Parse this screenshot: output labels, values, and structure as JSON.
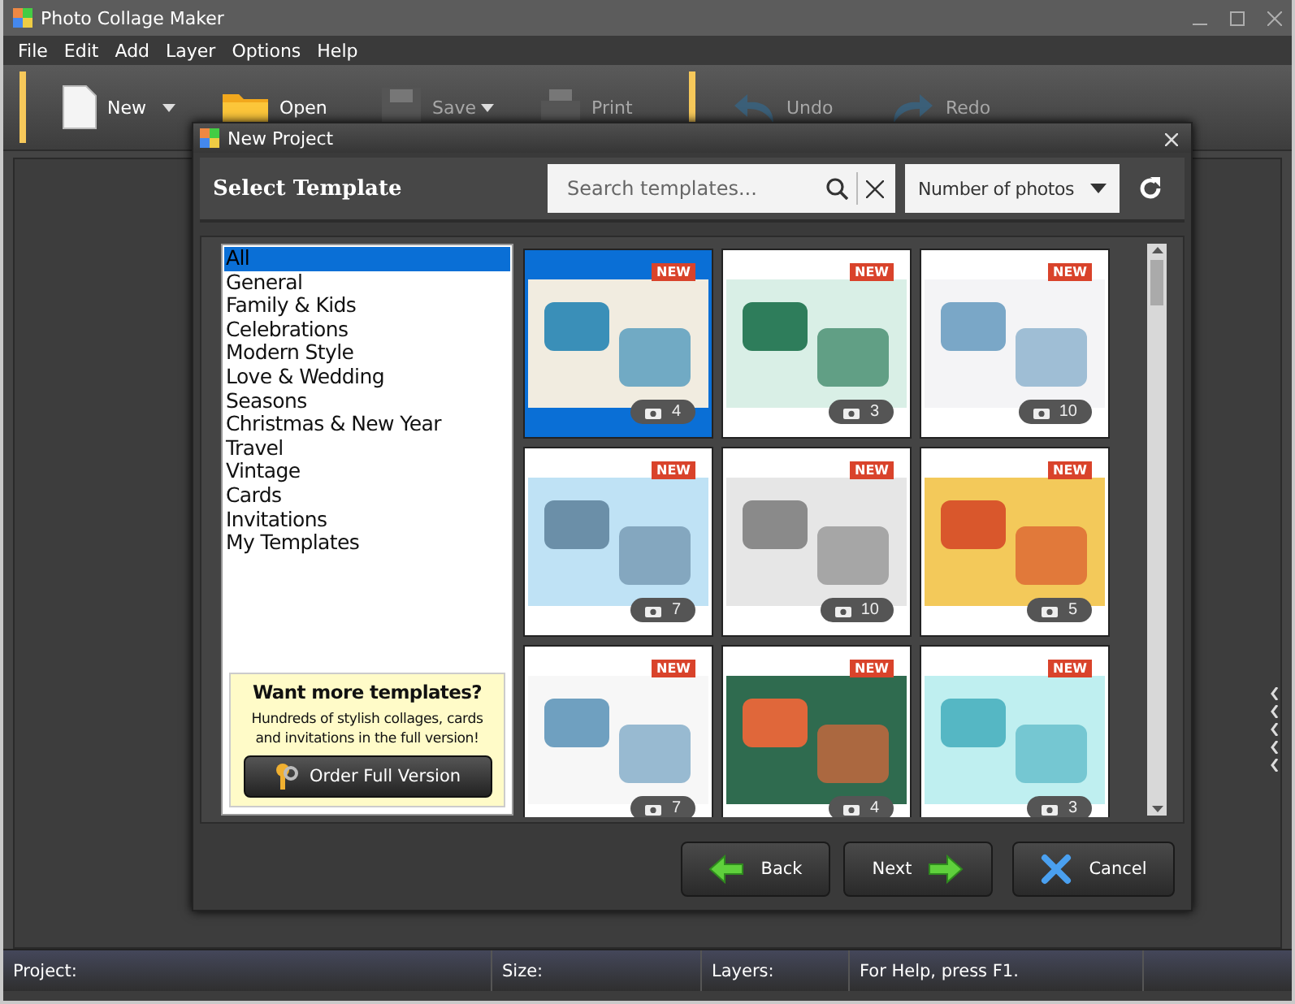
{
  "window": {
    "title": "Photo Collage Maker"
  },
  "menu": [
    "File",
    "Edit",
    "Add",
    "Layer",
    "Options",
    "Help"
  ],
  "toolbar": [
    {
      "label": "New",
      "kind": "new",
      "disabled": false,
      "dropdown": true
    },
    {
      "label": "Open",
      "kind": "open",
      "disabled": false,
      "dropdown": false
    },
    {
      "label": "Save",
      "kind": "save",
      "disabled": true,
      "dropdown": true
    },
    {
      "label": "Print",
      "kind": "print",
      "disabled": true,
      "dropdown": false
    },
    {
      "label": "Undo",
      "kind": "undo",
      "disabled": true,
      "dropdown": false
    },
    {
      "label": "Redo",
      "kind": "redo",
      "disabled": true,
      "dropdown": false
    }
  ],
  "dialog": {
    "title": "New Project",
    "heading": "Select Template",
    "search": {
      "placeholder": "Search templates..."
    },
    "sort": {
      "value": "Number of photos"
    },
    "categories": [
      {
        "label": "All",
        "selected": true
      },
      {
        "label": "General",
        "selected": false
      },
      {
        "label": "Family & Kids",
        "selected": false
      },
      {
        "label": "Celebrations",
        "selected": false
      },
      {
        "label": "Modern Style",
        "selected": false
      },
      {
        "label": "Love & Wedding",
        "selected": false
      },
      {
        "label": "Seasons",
        "selected": false
      },
      {
        "label": "Christmas & New Year",
        "selected": false
      },
      {
        "label": "Travel",
        "selected": false
      },
      {
        "label": "Vintage",
        "selected": false
      },
      {
        "label": "Cards",
        "selected": false
      },
      {
        "label": "Invitations",
        "selected": false
      },
      {
        "label": "My Templates",
        "selected": false
      }
    ],
    "promo": {
      "title": "Want more templates?",
      "text": "Hundreds of stylish collages, cards and invitations in the full version!",
      "button": "Order Full Version"
    },
    "templates": [
      {
        "badge": "NEW",
        "photos": "4",
        "selected": true
      },
      {
        "badge": "NEW",
        "photos": "3",
        "selected": false
      },
      {
        "badge": "NEW",
        "photos": "10",
        "selected": false
      },
      {
        "badge": "NEW",
        "photos": "7",
        "selected": false
      },
      {
        "badge": "NEW",
        "photos": "10",
        "selected": false
      },
      {
        "badge": "NEW",
        "photos": "5",
        "selected": false
      },
      {
        "badge": "NEW",
        "photos": "7",
        "selected": false
      },
      {
        "badge": "NEW",
        "photos": "4",
        "selected": false
      },
      {
        "badge": "NEW",
        "photos": "3",
        "selected": false
      }
    ],
    "buttons": [
      {
        "label": "Back",
        "kind": "back"
      },
      {
        "label": "Next",
        "kind": "next"
      },
      {
        "label": "Cancel",
        "kind": "cancel"
      }
    ]
  },
  "status_bar": [
    "Project:",
    "Size:",
    "Layers:",
    "For Help, press F1."
  ]
}
